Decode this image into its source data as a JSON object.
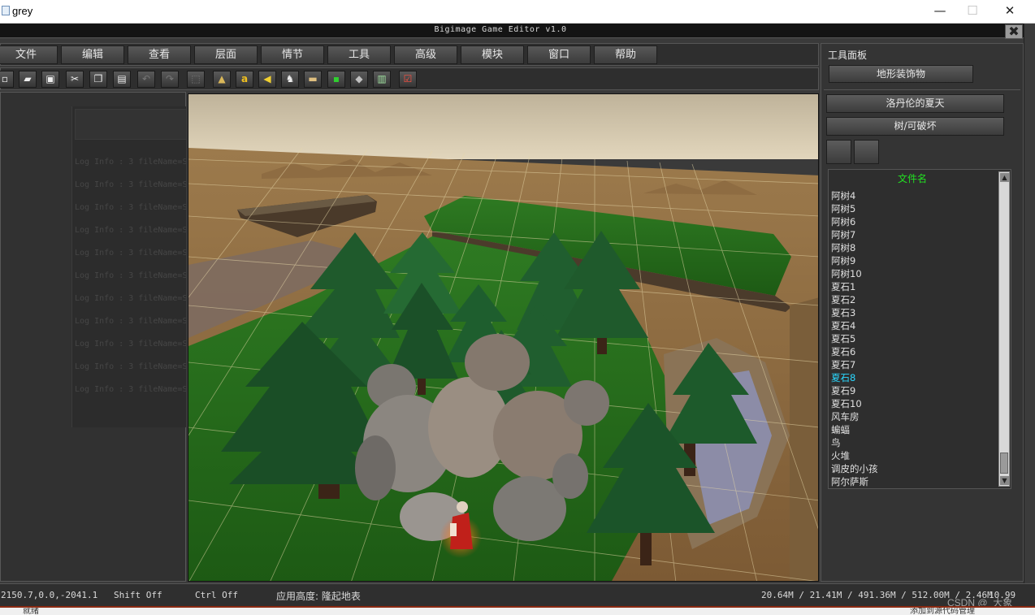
{
  "window": {
    "title": "grey",
    "min_glyph": "—",
    "max_glyph": "☐",
    "close_glyph": "✕"
  },
  "editor": {
    "title": "Bigimage Game Editor v1.0",
    "close_glyph": "✖"
  },
  "menu": {
    "items": [
      {
        "label": "文件"
      },
      {
        "label": "编辑"
      },
      {
        "label": "查看"
      },
      {
        "label": "层面"
      },
      {
        "label": "情节"
      },
      {
        "label": "工具"
      },
      {
        "label": "高级"
      },
      {
        "label": "模块"
      },
      {
        "label": "窗口"
      },
      {
        "label": "帮助"
      }
    ]
  },
  "toolbar": {
    "buttons": [
      {
        "icon": "new-file-icon",
        "glyph": "▫"
      },
      {
        "icon": "open-folder-icon",
        "glyph": "▰"
      },
      {
        "icon": "save-icon",
        "glyph": "▣"
      },
      {
        "icon": "cut-icon",
        "glyph": "✂"
      },
      {
        "icon": "copy-icon",
        "glyph": "❐"
      },
      {
        "icon": "paste-icon",
        "glyph": "▤"
      },
      {
        "icon": "undo-icon",
        "glyph": "↶"
      },
      {
        "icon": "redo-icon",
        "glyph": "↷"
      },
      {
        "icon": "select-icon",
        "glyph": "⬚"
      },
      {
        "icon": "terrain-icon",
        "glyph": "▲"
      },
      {
        "icon": "text-icon",
        "glyph": "a"
      },
      {
        "icon": "sound-icon",
        "glyph": "◀"
      },
      {
        "icon": "unit-icon",
        "glyph": "♞"
      },
      {
        "icon": "building-icon",
        "glyph": "▬"
      },
      {
        "icon": "terminal-icon",
        "glyph": "▪"
      },
      {
        "icon": "object-icon",
        "glyph": "◆"
      },
      {
        "icon": "document-icon",
        "glyph": "▥"
      },
      {
        "icon": "checkbox-icon",
        "glyph": "☑"
      }
    ]
  },
  "log": {
    "lines": [
      "Log Info : 3  fileName=S",
      "Log Info : 3  fileName=S",
      "Log Info : 3  fileName=S",
      "Log Info : 3  fileName=S",
      "Log Info : 3  fileName=S",
      "Log Info : 3  fileName=S",
      "Log Info : 3  fileName=S",
      "Log Info : 3  fileName=S",
      "Log Info : 3  fileName=S",
      "Log Info : 3  fileName=S",
      "Log Info : 3  fileName=S"
    ]
  },
  "right_panel": {
    "title": "工具面板",
    "category": "地形装饰物",
    "tileset": "洛丹伦的夏天",
    "subcategory": "树/可破坏",
    "file_header": "文件名",
    "selected_index": 15,
    "files": [
      "阿树4",
      "阿树5",
      "阿树6",
      "阿树7",
      "阿树8",
      "阿树9",
      "阿树10",
      "夏石1",
      "夏石2",
      "夏石3",
      "夏石4",
      "夏石5",
      "夏石6",
      "夏石7",
      "夏石8",
      "夏石9",
      "夏石10",
      "风车房",
      "蝙蝠",
      "鸟",
      "火堆",
      "调皮的小孩",
      "阿尔萨斯"
    ]
  },
  "status": {
    "coords": "2150.7,0.0,-2041.1",
    "shift": "Shift Off",
    "ctrl": "Ctrl Off",
    "height_mode": "应用高度: 隆起地表",
    "memory": "20.64M / 21.41M / 491.36M / 512.00M / 2.46M",
    "fps": "10.99"
  },
  "bottom": {
    "left": "就绪",
    "right": "添加到源代码管理"
  },
  "watermark": "CSDN @_大象_",
  "colors": {
    "accent_green": "#22e022",
    "selected_cyan": "#2ad8ff",
    "panel_bg": "#343434"
  }
}
